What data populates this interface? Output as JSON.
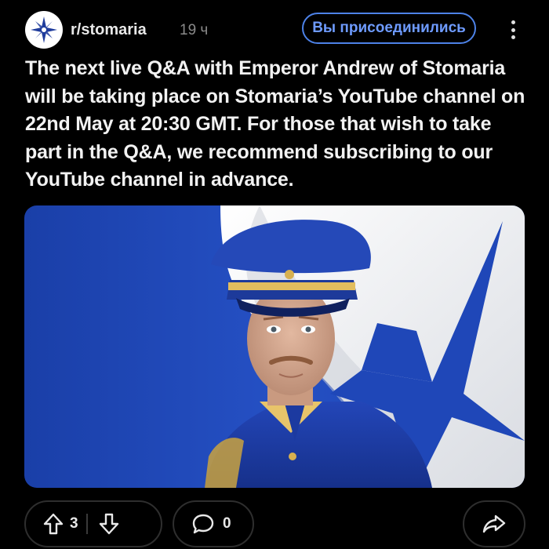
{
  "header": {
    "subreddit": "r/stomaria",
    "age": "19 ч",
    "join_label": "Вы присоединились"
  },
  "post": {
    "text": "The next live Q&A with Emperor Andrew of Stomaria will be taking place on Stomaria’s YouTube channel on 22nd May at 20:30 GMT. For those that wish to take part in the Q&A, we recommend subscribing to our YouTube channel in advance."
  },
  "actions": {
    "upvotes": "3",
    "comments": "0"
  },
  "colors": {
    "background": "#000000",
    "accent": "#4d82e8",
    "flag_blue": "#1f47b8",
    "flag_white": "#f2f3f5"
  },
  "icons": {
    "avatar": "star-emblem-icon",
    "more": "more-vertical-icon",
    "upvote": "arrow-up-icon",
    "downvote": "arrow-down-icon",
    "comment": "comment-bubble-icon",
    "share": "share-arrow-icon"
  }
}
